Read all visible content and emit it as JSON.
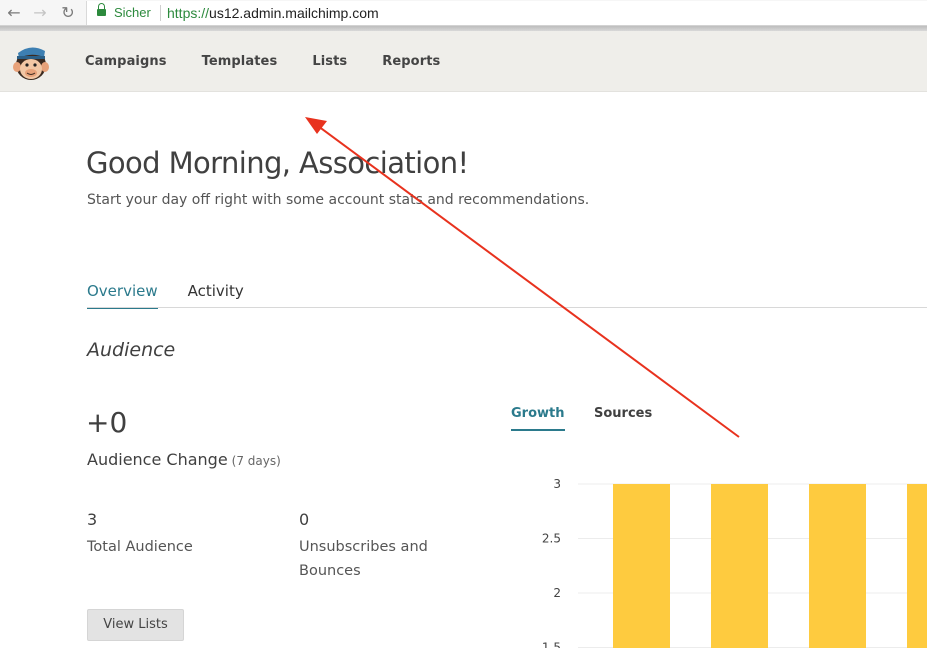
{
  "browser": {
    "secure_label": "Sicher",
    "url_scheme": "https://",
    "url_host": "us12.admin.mailchimp.com"
  },
  "nav": {
    "items": [
      {
        "label": "Campaigns"
      },
      {
        "label": "Templates"
      },
      {
        "label": "Lists"
      },
      {
        "label": "Reports"
      }
    ]
  },
  "header": {
    "greeting": "Good Morning, Association!",
    "subtitle": "Start your day off right with some account stats and recommendations."
  },
  "tabs": [
    {
      "label": "Overview",
      "active": true
    },
    {
      "label": "Activity",
      "active": false
    }
  ],
  "audience": {
    "section_title": "Audience",
    "change_value": "+0",
    "change_label": "Audience Change",
    "change_period": "(7 days)",
    "total_value": "3",
    "total_label": "Total Audience",
    "unsub_value": "0",
    "unsub_label_line1": "Unsubscribes and",
    "unsub_label_line2": "Bounces",
    "view_button": "View Lists"
  },
  "chart_tabs": [
    {
      "label": "Growth",
      "active": true
    },
    {
      "label": "Sources",
      "active": false
    }
  ],
  "colors": {
    "accent": "#2b7a8c",
    "bar": "#fecb3f",
    "annotation_arrow": "#e8321e"
  },
  "chart_data": {
    "type": "bar",
    "y_ticks": [
      "3",
      "2.5",
      "2",
      "1.5"
    ],
    "ylim": [
      1.5,
      3
    ],
    "values": [
      3,
      3,
      3,
      3
    ],
    "grid": true
  }
}
